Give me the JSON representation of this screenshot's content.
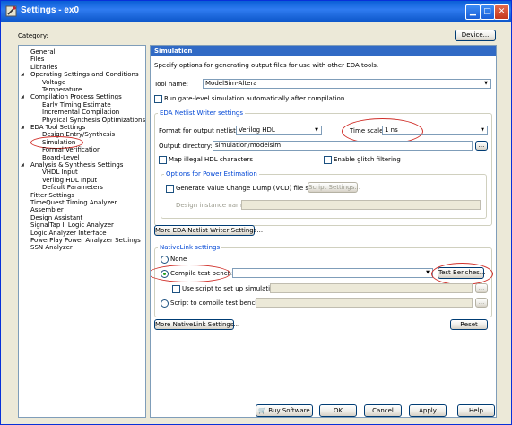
{
  "window": {
    "title": "Settings - ex0"
  },
  "category_label": "Category:",
  "device_button": "Device...",
  "tree": [
    {
      "label": "General",
      "level": 0
    },
    {
      "label": "Files",
      "level": 0
    },
    {
      "label": "Libraries",
      "level": 0
    },
    {
      "label": "Operating Settings and Conditions",
      "level": 0,
      "expanded": true
    },
    {
      "label": "Voltage",
      "level": 1
    },
    {
      "label": "Temperature",
      "level": 1
    },
    {
      "label": "Compilation Process Settings",
      "level": 0,
      "expanded": true
    },
    {
      "label": "Early Timing Estimate",
      "level": 1
    },
    {
      "label": "Incremental Compilation",
      "level": 1
    },
    {
      "label": "Physical Synthesis Optimizations",
      "level": 1
    },
    {
      "label": "EDA Tool Settings",
      "level": 0,
      "expanded": true
    },
    {
      "label": "Design Entry/Synthesis",
      "level": 1
    },
    {
      "label": "Simulation",
      "level": 1,
      "selected": true
    },
    {
      "label": "Formal Verification",
      "level": 1
    },
    {
      "label": "Board-Level",
      "level": 1
    },
    {
      "label": "Analysis & Synthesis Settings",
      "level": 0,
      "expanded": true
    },
    {
      "label": "VHDL Input",
      "level": 1
    },
    {
      "label": "Verilog HDL Input",
      "level": 1
    },
    {
      "label": "Default Parameters",
      "level": 1
    },
    {
      "label": "Fitter Settings",
      "level": 0
    },
    {
      "label": "TimeQuest Timing Analyzer",
      "level": 0
    },
    {
      "label": "Assembler",
      "level": 0
    },
    {
      "label": "Design Assistant",
      "level": 0
    },
    {
      "label": "SignalTap II Logic Analyzer",
      "level": 0
    },
    {
      "label": "Logic Analyzer Interface",
      "level": 0
    },
    {
      "label": "PowerPlay Power Analyzer Settings",
      "level": 0
    },
    {
      "label": "SSN Analyzer",
      "level": 0
    }
  ],
  "panel": {
    "heading": "Simulation",
    "description": "Specify options for generating output files for use with other EDA tools.",
    "tool_name_label": "Tool name:",
    "tool_name_value": "ModelSim-Altera",
    "run_gate_level_label": "Run gate-level simulation automatically after compilation",
    "eda_group_title": "EDA Netlist Writer settings",
    "format_label": "Format for output netlist:",
    "format_value": "Verilog HDL",
    "time_scale_label": "Time scale:",
    "time_scale_value": "1 ns",
    "output_dir_label": "Output directory:",
    "output_dir_value": "simulation/modelsim",
    "browse": "...",
    "map_illegal_label": "Map illegal HDL characters",
    "enable_glitch_label": "Enable glitch filtering",
    "power_group_title": "Options for Power Estimation",
    "vcd_label": "Generate Value Change Dump (VCD) file script",
    "script_settings_button": "Script Settings...",
    "design_instance_label": "Design instance name:",
    "more_eda_button": "More EDA Netlist Writer Settings...",
    "nativelink_group_title": "NativeLink settings",
    "none_label": "None",
    "compile_tb_label": "Compile test bench:",
    "test_benches_button": "Test Benches...",
    "use_script_label": "Use script to set up simulation:",
    "script_compile_label": "Script to compile test bench:",
    "more_nativelink_button": "More NativeLink Settings...",
    "reset_button": "Reset"
  },
  "footer": {
    "buy": "Buy Software",
    "ok": "OK",
    "cancel": "Cancel",
    "apply": "Apply",
    "help": "Help"
  },
  "colors": {
    "titlebar": "#0a5fd6",
    "selection": "#316ac5",
    "highlight_ellipse": "#d0302a"
  }
}
